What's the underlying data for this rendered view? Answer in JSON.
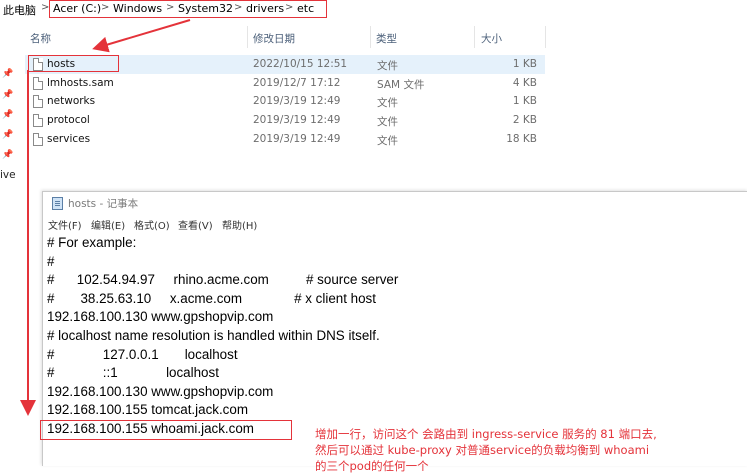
{
  "breadcrumb": {
    "root": "此电脑",
    "items": [
      "Acer (C:)",
      "Windows",
      "System32",
      "drivers",
      "etc"
    ],
    "separator": ">"
  },
  "columns": {
    "name": "名称",
    "date": "修改日期",
    "type": "类型",
    "size": "大小"
  },
  "files": [
    {
      "name": "hosts",
      "date": "2022/10/15 12:51",
      "type": "文件",
      "size": "1 KB",
      "selected": true
    },
    {
      "name": "lmhosts.sam",
      "date": "2019/12/7 17:12",
      "type": "SAM 文件",
      "size": "4 KB"
    },
    {
      "name": "networks",
      "date": "2019/3/19 12:49",
      "type": "文件",
      "size": "1 KB"
    },
    {
      "name": "protocol",
      "date": "2019/3/19 12:49",
      "type": "文件",
      "size": "2 KB"
    },
    {
      "name": "services",
      "date": "2019/3/19 12:49",
      "type": "文件",
      "size": "18 KB"
    }
  ],
  "sidebar_fragment": "ive",
  "notepad": {
    "title": "hosts - 记事本",
    "menu": [
      "文件(F)",
      "编辑(E)",
      "格式(O)",
      "查看(V)",
      "帮助(H)"
    ],
    "lines": [
      "# For example:",
      "#",
      "#      102.54.94.97     rhino.acme.com          # source server",
      "#       38.25.63.10     x.acme.com              # x client host",
      "192.168.100.130 www.gpshopvip.com",
      "# localhost name resolution is handled within DNS itself.",
      "#             127.0.0.1       localhost",
      "#             ::1             localhost",
      "192.168.100.130 www.gpshopvip.com",
      "192.168.100.155 tomcat.jack.com",
      "192.168.100.155 whoami.jack.com"
    ]
  },
  "annotation": {
    "lines": [
      "增加一行，访问这个 会路由到 ingress-service 服务的 81 端口去,",
      "然后可以通过 kube-proxy 对普通service的负载均衡到 whoami",
      "的三个pod的任何一个"
    ]
  },
  "colors": {
    "annotation_red": "#e4333a",
    "selection": "#e5f1fb"
  }
}
